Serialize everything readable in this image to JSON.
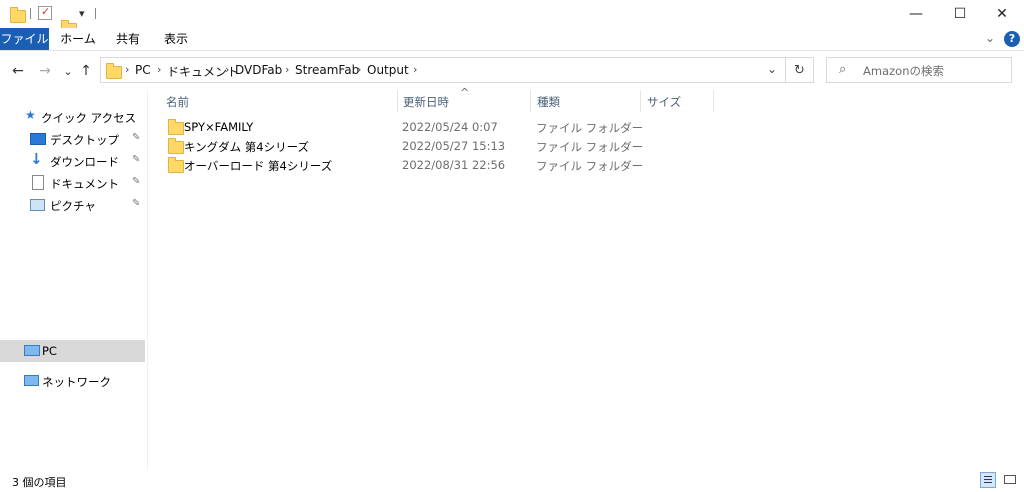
{
  "window": {
    "min_glyph": "—",
    "max_glyph": "☐",
    "close_glyph": "✕",
    "qa_dropdown_glyph": "▾"
  },
  "ribbon": {
    "tabs": [
      "ファイル",
      "ホーム",
      "共有",
      "表示"
    ],
    "expand_glyph": "⌄",
    "help_glyph": "?"
  },
  "nav": {
    "back": "←",
    "forward": "→",
    "recent": "⌄",
    "up": "↑"
  },
  "address": {
    "crumbs": [
      "PC",
      "ドキュメント",
      "DVDFab",
      "StreamFab",
      "Output"
    ],
    "sep": "›",
    "dropdown_glyph": "⌄",
    "refresh_glyph": "↻"
  },
  "search": {
    "placeholder": "Amazonの検索",
    "icon_glyph": "⌕"
  },
  "navpane": {
    "quick_access": "クイック アクセス",
    "items": [
      {
        "label": "デスクトップ",
        "icon": "desktop-icon"
      },
      {
        "label": "ダウンロード",
        "icon": "download-icon"
      },
      {
        "label": "ドキュメント",
        "icon": "document-icon"
      },
      {
        "label": "ピクチャ",
        "icon": "picture-icon"
      }
    ],
    "pin_glyph": "📌",
    "pc": "PC",
    "network": "ネットワーク"
  },
  "columns": {
    "name": "名前",
    "date": "更新日時",
    "type": "種類",
    "size": "サイズ",
    "sort_glyph": "^"
  },
  "files": [
    {
      "name": "SPY×FAMILY",
      "date": "2022/05/24 0:07",
      "type": "ファイル フォルダー"
    },
    {
      "name": "キングダム 第4シリーズ",
      "date": "2022/05/27 15:13",
      "type": "ファイル フォルダー"
    },
    {
      "name": "オーバーロード 第4シリーズ",
      "date": "2022/08/31 22:56",
      "type": "ファイル フォルダー"
    }
  ],
  "status": {
    "item_count": "3 個の項目"
  },
  "colors": {
    "accent": "#1a5fb4",
    "folder": "#ffd866",
    "selected_bg": "#d9d9d9"
  }
}
